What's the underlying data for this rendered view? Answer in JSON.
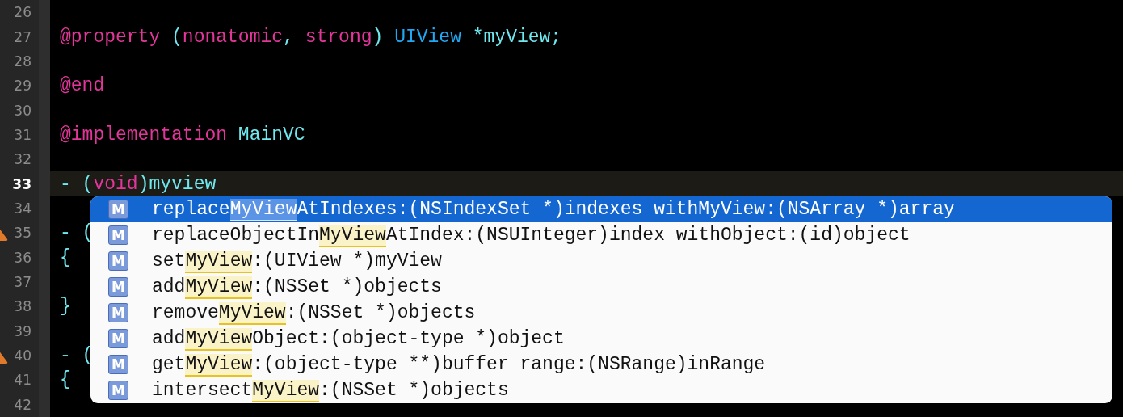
{
  "lines": [
    {
      "number": "26",
      "current": false,
      "warning": false
    },
    {
      "number": "27",
      "current": false,
      "warning": false,
      "tokens": [
        {
          "text": "@property",
          "kind": "keyword"
        },
        {
          "text": " (",
          "kind": "plain"
        },
        {
          "text": "nonatomic",
          "kind": "keyword"
        },
        {
          "text": ", ",
          "kind": "plain"
        },
        {
          "text": "strong",
          "kind": "keyword"
        },
        {
          "text": ") ",
          "kind": "plain"
        },
        {
          "text": "UIView",
          "kind": "type"
        },
        {
          "text": " *myView;",
          "kind": "plain"
        }
      ]
    },
    {
      "number": "28",
      "current": false,
      "warning": false
    },
    {
      "number": "29",
      "current": false,
      "warning": false,
      "tokens": [
        {
          "text": "@end",
          "kind": "keyword"
        }
      ]
    },
    {
      "number": "30",
      "current": false,
      "warning": false
    },
    {
      "number": "31",
      "current": false,
      "warning": false,
      "tokens": [
        {
          "text": "@implementation",
          "kind": "keyword"
        },
        {
          "text": " MainVC",
          "kind": "plain"
        }
      ]
    },
    {
      "number": "32",
      "current": false,
      "warning": false
    },
    {
      "number": "33",
      "current": true,
      "warning": false,
      "tokens": [
        {
          "text": "- (",
          "kind": "plain"
        },
        {
          "text": "void",
          "kind": "keyword"
        },
        {
          "text": ")myview",
          "kind": "plain"
        }
      ]
    },
    {
      "number": "34",
      "current": false,
      "warning": false
    },
    {
      "number": "35",
      "current": false,
      "warning": true,
      "tokens": [
        {
          "text": "- (",
          "kind": "plain"
        }
      ]
    },
    {
      "number": "36",
      "current": false,
      "warning": false,
      "tokens": [
        {
          "text": "{",
          "kind": "plain"
        }
      ]
    },
    {
      "number": "37",
      "current": false,
      "warning": false
    },
    {
      "number": "38",
      "current": false,
      "warning": false,
      "tokens": [
        {
          "text": "}",
          "kind": "plain"
        }
      ]
    },
    {
      "number": "39",
      "current": false,
      "warning": false
    },
    {
      "number": "40",
      "current": false,
      "warning": true,
      "tokens": [
        {
          "text": "- (",
          "kind": "plain"
        }
      ]
    },
    {
      "number": "41",
      "current": false,
      "warning": false,
      "tokens": [
        {
          "text": "{",
          "kind": "plain"
        }
      ]
    },
    {
      "number": "42",
      "current": false,
      "warning": false
    }
  ],
  "completions": [
    {
      "icon": "M",
      "selected": true,
      "parts": [
        {
          "text": "replace",
          "match": false
        },
        {
          "text": "MyView",
          "match": true
        },
        {
          "text": "AtIndexes:(NSIndexSet *)indexes withMyView:(NSArray *)array",
          "match": false
        }
      ]
    },
    {
      "icon": "M",
      "selected": false,
      "parts": [
        {
          "text": "replaceObjectIn",
          "match": false
        },
        {
          "text": "MyView",
          "match": true
        },
        {
          "text": "AtIndex:(NSUInteger)index withObject:(id)object",
          "match": false
        }
      ]
    },
    {
      "icon": "M",
      "selected": false,
      "parts": [
        {
          "text": "set",
          "match": false
        },
        {
          "text": "MyView",
          "match": true
        },
        {
          "text": ":(UIView *)myView",
          "match": false
        }
      ]
    },
    {
      "icon": "M",
      "selected": false,
      "parts": [
        {
          "text": "add",
          "match": false
        },
        {
          "text": "MyView",
          "match": true
        },
        {
          "text": ":(NSSet *)objects",
          "match": false
        }
      ]
    },
    {
      "icon": "M",
      "selected": false,
      "parts": [
        {
          "text": "remove",
          "match": false
        },
        {
          "text": "MyView",
          "match": true
        },
        {
          "text": ":(NSSet *)objects",
          "match": false
        }
      ]
    },
    {
      "icon": "M",
      "selected": false,
      "parts": [
        {
          "text": "add",
          "match": false
        },
        {
          "text": "MyView",
          "match": true
        },
        {
          "text": "Object:(object-type *)object",
          "match": false
        }
      ]
    },
    {
      "icon": "M",
      "selected": false,
      "parts": [
        {
          "text": "get",
          "match": false
        },
        {
          "text": "MyView",
          "match": true
        },
        {
          "text": ":(object-type **)buffer range:(NSRange)inRange",
          "match": false
        }
      ]
    },
    {
      "icon": "M",
      "selected": false,
      "parts": [
        {
          "text": "intersect",
          "match": false
        },
        {
          "text": "MyView",
          "match": true
        },
        {
          "text": ":(NSSet *)objects",
          "match": false
        }
      ]
    }
  ]
}
